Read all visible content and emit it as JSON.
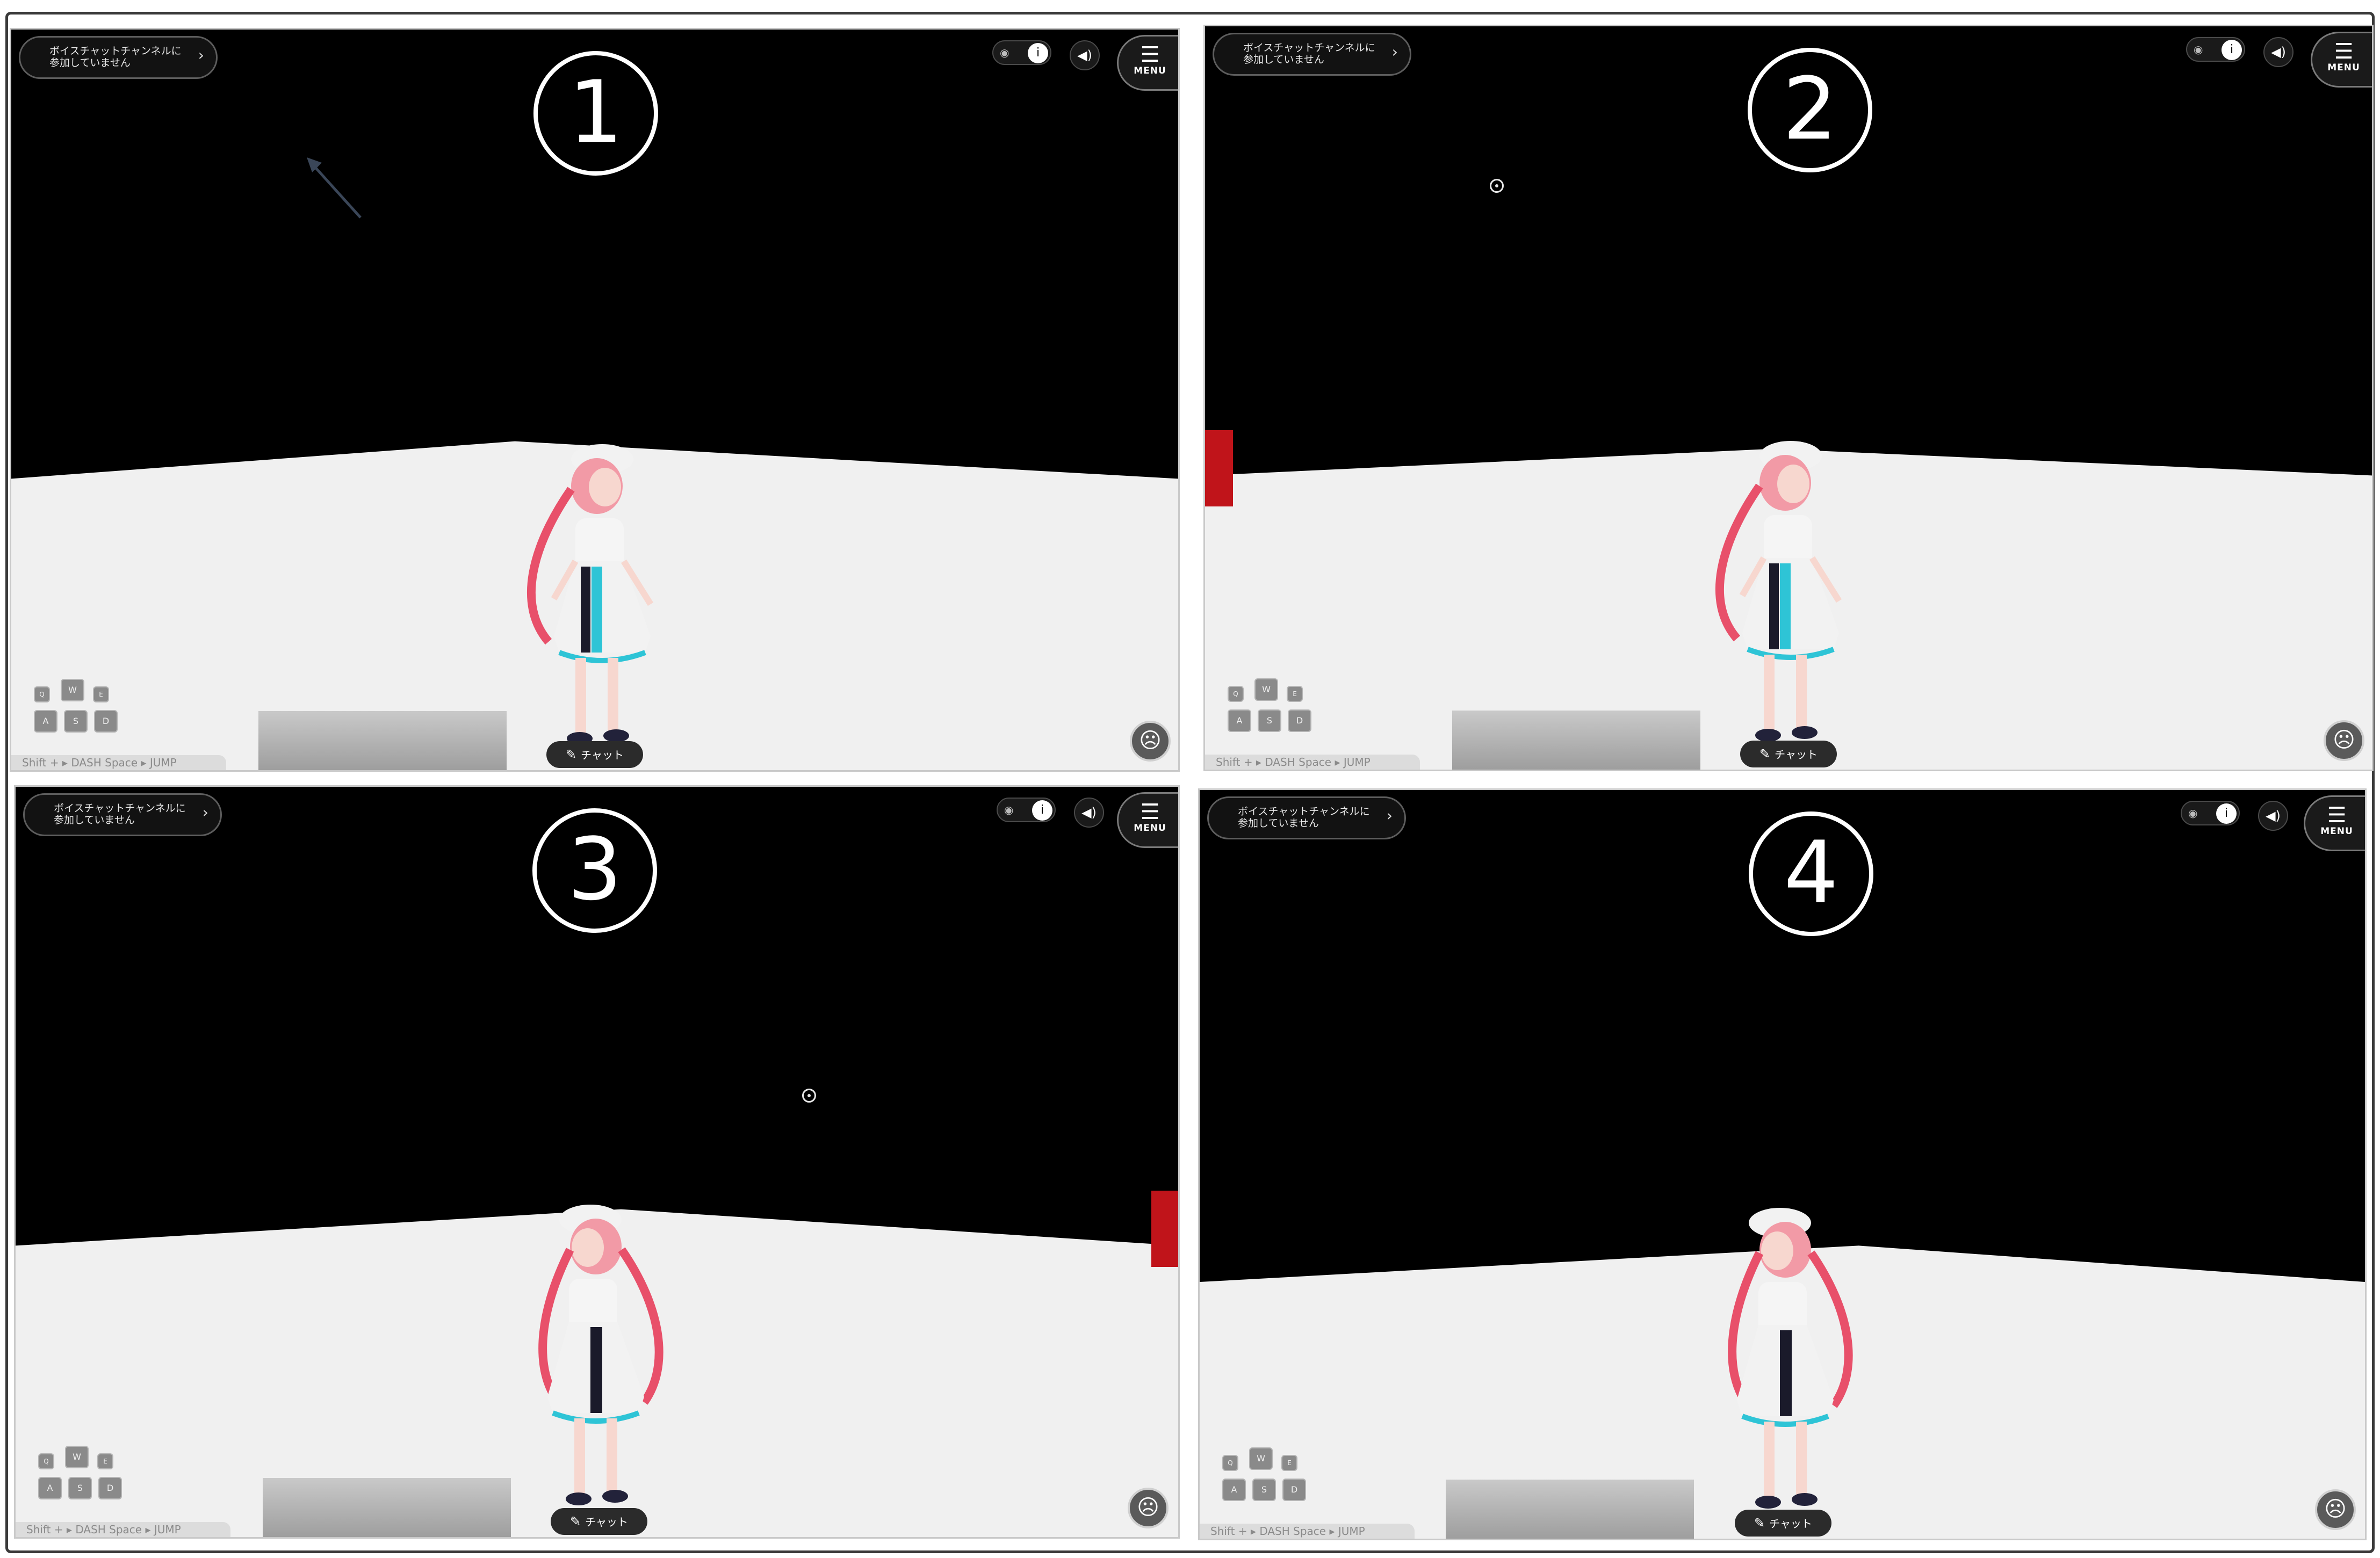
{
  "ui": {
    "voice_chat_status": "ボイスチャットチャンネルに\n参加していません",
    "menu_label": "MENU",
    "chat_label": "チャット",
    "hint_text": "Shift + ▸ DASH   Space ▸ JUMP",
    "keys": {
      "q": "Q",
      "w": "W",
      "e": "E",
      "a": "A",
      "s": "S",
      "d": "D"
    },
    "icons": {
      "voice_chevron": "›",
      "eye": "◉",
      "person": "ⅰ",
      "volume": "◀)",
      "menu": "☰",
      "chat": "✎",
      "face": "☹"
    }
  },
  "panels": [
    {
      "badge": "1"
    },
    {
      "badge": "2"
    },
    {
      "badge": "3"
    },
    {
      "badge": "4"
    }
  ],
  "colors": {
    "sky": "#000000",
    "floor": "#f0f0f0",
    "wall_marker": "#c0141a",
    "avatar_hair": "#f29aa6",
    "avatar_dress": "#f2f2f2",
    "avatar_accent": "#2ec4d6"
  }
}
